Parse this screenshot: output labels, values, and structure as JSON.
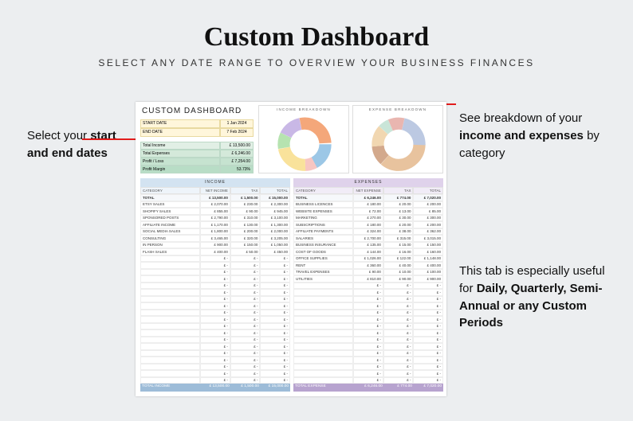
{
  "title": "Custom Dashboard",
  "subtitle": "SELECT ANY DATE RANGE TO OVERVIEW YOUR BUSINESS FINANCES",
  "annot_left_pre": "Select your ",
  "annot_left_bold": "start and end dates",
  "annot_rt_pre": "See breakdown of your ",
  "annot_rt_bold": "income and expenses",
  "annot_rt_post": " by category",
  "annot_rb_pre": "This tab is especially useful for ",
  "annot_rb_bold": "Daily, Quarterly, Semi-Annual or any Custom Periods",
  "sheet_title": "CUSTOM DASHBOARD",
  "dates": {
    "start_label": "START DATE",
    "start_val": "1 Jan 2024",
    "end_label": "END DATE",
    "end_val": "7 Feb 2024"
  },
  "kpis": [
    {
      "label": "Total Income",
      "val": "£   13,500.00"
    },
    {
      "label": "Total Expenses",
      "val": "£    6,246.00"
    },
    {
      "label": "Profit / Loss",
      "val": "£    7,254.00"
    },
    {
      "label": "Profit Margin",
      "val": "53.73%"
    }
  ],
  "chart_data": [
    {
      "type": "pie",
      "title": "INCOME BREAKDOWN",
      "series": [
        {
          "name": "ETSY SALES",
          "value": 2300
        },
        {
          "name": "SHOPIFY SALES",
          "value": 945
        },
        {
          "name": "SPONSORED POSTS",
          "value": 3090
        },
        {
          "name": "AFFILIATE INCOME",
          "value": 1300
        },
        {
          "name": "SOCIAL MEDIA SALES",
          "value": 2000
        },
        {
          "name": "CONSULTING",
          "value": 3665
        },
        {
          "name": "IN PERSON",
          "value": 1050
        },
        {
          "name": "FLASH SALES",
          "value": 450
        }
      ]
    },
    {
      "type": "pie",
      "title": "EXPENSE BREAKDOWN",
      "series": [
        {
          "name": "BUSINESS LICENCES",
          "value": 200
        },
        {
          "name": "WEBSITE EXPENSES",
          "value": 85
        },
        {
          "name": "MARKETING",
          "value": 300
        },
        {
          "name": "SUBSCRIPTIONS",
          "value": 200
        },
        {
          "name": "AFFILIATE PAYMENTS",
          "value": 362
        },
        {
          "name": "SALARIES",
          "value": 3015
        },
        {
          "name": "BUSINESS INSURANCE",
          "value": 150
        },
        {
          "name": "COST OF GOODS",
          "value": 160
        },
        {
          "name": "OFFICE SUPPLIES",
          "value": 1148
        },
        {
          "name": "RENT",
          "value": 400
        },
        {
          "name": "TRAVEL EXPENSES",
          "value": 100
        },
        {
          "name": "UTILITIES",
          "value": 900
        }
      ]
    }
  ],
  "income_table": {
    "title": "INCOME",
    "head": [
      "CATEGORY",
      "NET INCOME",
      "TAX",
      "TOTAL"
    ],
    "total_row": [
      "TOTAL",
      "£ 13,500.00",
      "£ 1,500.00",
      "£ 15,000.00"
    ],
    "rows": [
      [
        "ETSY SALES",
        "£  2,070.00",
        "£   230.00",
        "£  2,300.00"
      ],
      [
        "SHOPIFY SALES",
        "£    855.00",
        "£    90.00",
        "£    945.00"
      ],
      [
        "SPONSORED POSTS",
        "£  2,790.00",
        "£   310.00",
        "£  3,100.00"
      ],
      [
        "AFFILIATE INCOME",
        "£  1,170.00",
        "£   130.00",
        "£  1,300.00"
      ],
      [
        "SOCIAL MEDIA SALES",
        "£  1,800.00",
        "£   200.00",
        "£  2,000.00"
      ],
      [
        "CONSULTING",
        "£  3,465.00",
        "£   320.00",
        "£  3,205.00"
      ],
      [
        "IN PERSON",
        "£    900.00",
        "£   150.00",
        "£  1,050.00"
      ],
      [
        "FLASH SALES",
        "£    400.00",
        "£    50.00",
        "£    450.00"
      ]
    ],
    "foot": [
      "TOTAL INCOME",
      "£ 13,500.00",
      "£ 1,500.00",
      "£ 15,000.00"
    ]
  },
  "expense_table": {
    "title": "EXPENSES",
    "head": [
      "CATEGORY",
      "NET EXPENSE",
      "TAX",
      "TOTAL"
    ],
    "total_row": [
      "TOTAL",
      "£  6,246.00",
      "£   774.00",
      "£  7,020.00"
    ],
    "rows": [
      [
        "BUSINESS LICENCES",
        "£    180.00",
        "£    20.00",
        "£    200.00"
      ],
      [
        "WEBSITE EXPENSES",
        "£     72.00",
        "£    13.00",
        "£     85.00"
      ],
      [
        "MARKETING",
        "£    270.00",
        "£    30.00",
        "£    300.00"
      ],
      [
        "SUBSCRIPTIONS",
        "£    180.00",
        "£    20.00",
        "£    200.00"
      ],
      [
        "AFFILIATE PAYMENTS",
        "£    324.00",
        "£    38.00",
        "£    362.00"
      ],
      [
        "SALARIES",
        "£  2,700.00",
        "£   315.00",
        "£  3,015.00"
      ],
      [
        "BUSINESS INSURANCE",
        "£    135.00",
        "£    15.00",
        "£    150.00"
      ],
      [
        "COST OF GOODS",
        "£    144.00",
        "£    16.00",
        "£    160.00"
      ],
      [
        "OFFICE SUPPLIES",
        "£  1,026.00",
        "£   122.00",
        "£  1,148.00"
      ],
      [
        "RENT",
        "£    360.00",
        "£    40.00",
        "£    400.00"
      ],
      [
        "TRAVEL EXPENSES",
        "£     90.00",
        "£    10.00",
        "£    100.00"
      ],
      [
        "UTILITIES",
        "£    810.00",
        "£    90.00",
        "£    900.00"
      ]
    ],
    "foot": [
      "TOTAL EXPENSE",
      "£  6,246.00",
      "£   774.00",
      "£  7,020.00"
    ]
  }
}
